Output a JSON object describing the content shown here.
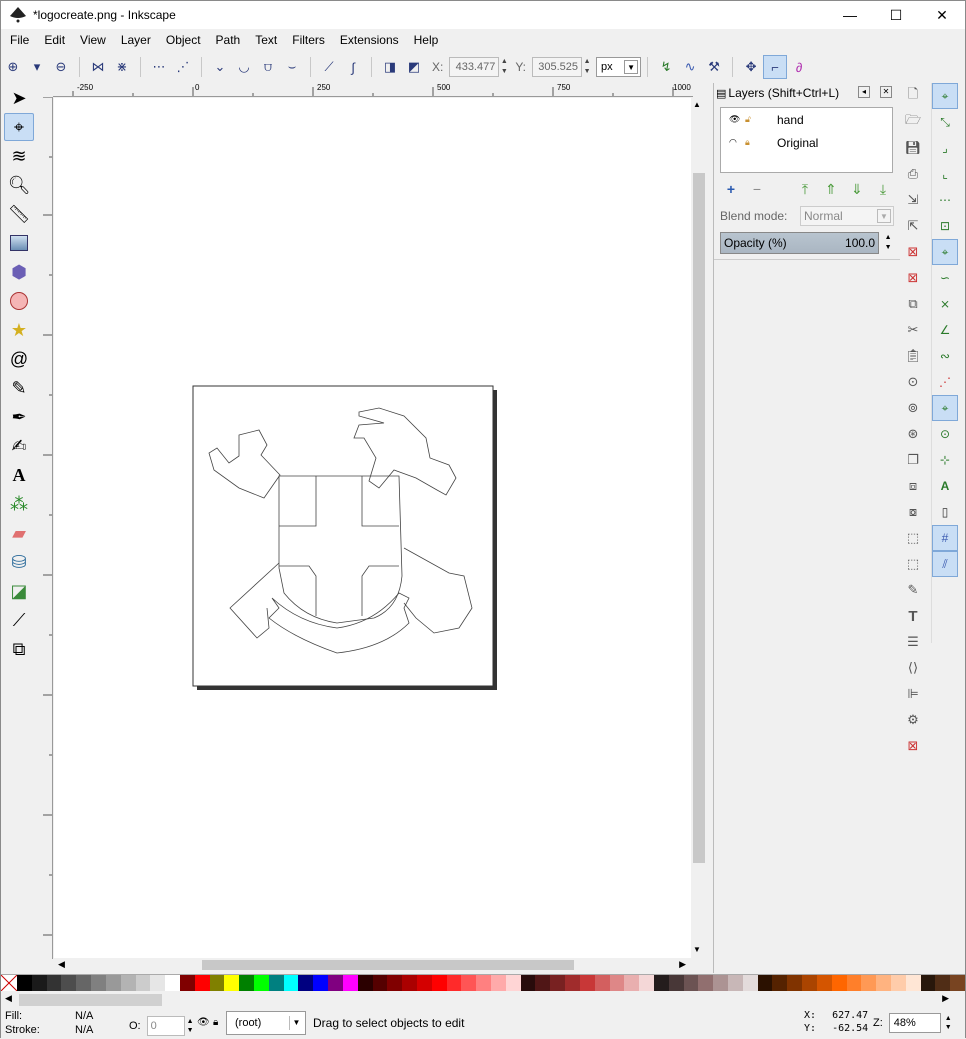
{
  "window": {
    "title": "*logocreate.png - Inkscape",
    "minimize": "—",
    "maximize": "☐",
    "close": "✕"
  },
  "menu": [
    "File",
    "Edit",
    "View",
    "Layer",
    "Object",
    "Path",
    "Text",
    "Filters",
    "Extensions",
    "Help"
  ],
  "toolbar": {
    "x_label": "X:",
    "x_value": "433.477",
    "y_label": "Y:",
    "y_value": "305.525",
    "unit": "px"
  },
  "ruler": {
    "h_ticks": [
      "-250",
      "0",
      "250",
      "500",
      "750",
      "1000"
    ],
    "v_ticks": [
      "-250",
      "0",
      "250",
      "500",
      "750",
      "1000"
    ]
  },
  "layers_panel": {
    "title": "Layers (Shift+Ctrl+L)",
    "layers": [
      {
        "name": "hand"
      },
      {
        "name": "Original"
      }
    ],
    "blend_label": "Blend mode:",
    "blend_value": "Normal",
    "opacity_label": "Opacity (%)",
    "opacity_value": "100.0"
  },
  "status": {
    "fill_label": "Fill:",
    "fill_value": "N/A",
    "stroke_label": "Stroke:",
    "stroke_value": "N/A",
    "o_label": "O:",
    "o_value": "0",
    "layer": "(root)",
    "message": "Drag to select objects to edit",
    "x_label": "X:",
    "x_value": "627.47",
    "y_label": "Y:",
    "y_value": "-62.54",
    "z_label": "Z:",
    "zoom": "48%"
  },
  "palette_colors": [
    "#000000",
    "#1a1a1a",
    "#333333",
    "#4d4d4d",
    "#666666",
    "#808080",
    "#999999",
    "#b3b3b3",
    "#cccccc",
    "#e6e6e6",
    "#ffffff",
    "#800000",
    "#ff0000",
    "#808000",
    "#ffff00",
    "#008000",
    "#00ff00",
    "#008080",
    "#00ffff",
    "#000080",
    "#0000ff",
    "#800080",
    "#ff00ff",
    "#2b0000",
    "#550000",
    "#800000",
    "#aa0000",
    "#d40000",
    "#ff0000",
    "#ff2a2a",
    "#ff5555",
    "#ff8080",
    "#ffaaaa",
    "#ffd5d5",
    "#280b0b",
    "#501616",
    "#782121",
    "#a02c2c",
    "#c83737",
    "#d35f5f",
    "#de8787",
    "#e9afaf",
    "#f4d7d7",
    "#241c1c",
    "#483737",
    "#6c5353",
    "#916f6f",
    "#ac9393",
    "#c8b7b7",
    "#e3dbdb",
    "#2b1100",
    "#552200",
    "#803300",
    "#aa4400",
    "#d45500",
    "#ff6600",
    "#ff7f2a",
    "#ff9955",
    "#ffb380",
    "#ffccaa",
    "#ffe6d5",
    "#28170b",
    "#502d16",
    "#784421"
  ]
}
